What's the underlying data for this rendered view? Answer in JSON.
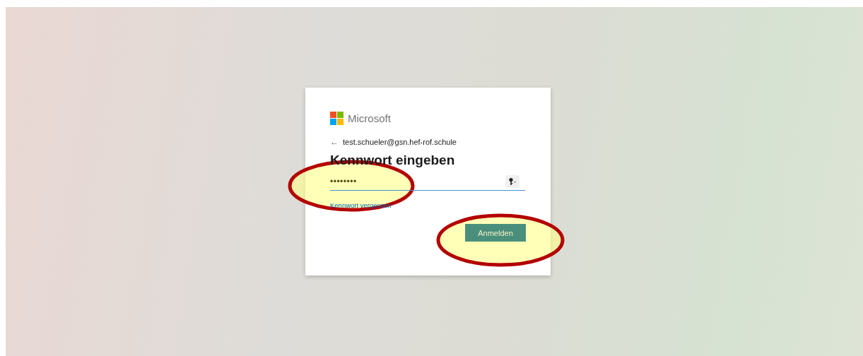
{
  "brand": {
    "name": "Microsoft"
  },
  "account": {
    "back": "←",
    "email": "test.schueler@gsn.hef-rof.schule"
  },
  "heading": "Kennwort eingeben",
  "password": {
    "value": "••••••••"
  },
  "forgot_link": "Kennwort vergessen",
  "submit_button": "Anmelden"
}
